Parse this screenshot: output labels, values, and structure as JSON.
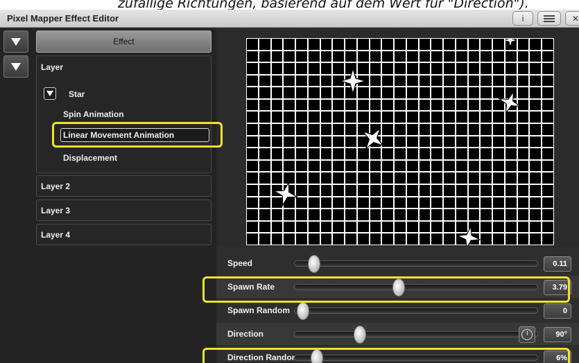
{
  "caption": "zufällige Richtungen, basierend auf dem Wert für \"Direction\").",
  "window": {
    "title": "Pixel Mapper Effect Editor",
    "info_label": "i",
    "close_label": "✕"
  },
  "sidebar": {
    "effect_label": "Effect",
    "layer": {
      "title": "Layer",
      "shape": "Star",
      "items": [
        "Spin Animation",
        "Linear Movement Animation",
        "Displacement"
      ],
      "selected": "Linear Movement Animation"
    },
    "other_layers": [
      "Layer 2",
      "Layer 3",
      "Layer 4"
    ]
  },
  "controls": [
    {
      "label": "Speed",
      "value": "0.11",
      "level": 0.05,
      "highlighted": false,
      "dial": false
    },
    {
      "label": "Spawn Rate",
      "value": "3.79",
      "level": 0.42,
      "highlighted": true,
      "dial": false
    },
    {
      "label": "Spawn Random",
      "value": "0",
      "level": 0.0,
      "highlighted": false,
      "dial": false
    },
    {
      "label": "Direction",
      "value": "90°",
      "level": 0.25,
      "highlighted": false,
      "dial": true
    },
    {
      "label": "Direction Random",
      "value": "6%",
      "level": 0.06,
      "highlighted": true,
      "dial": false
    }
  ],
  "colors": {
    "highlight": "#f2e22a",
    "panel": "#2b2b2b",
    "grid_line": "#ffffff",
    "grid_cell": "#000000"
  }
}
